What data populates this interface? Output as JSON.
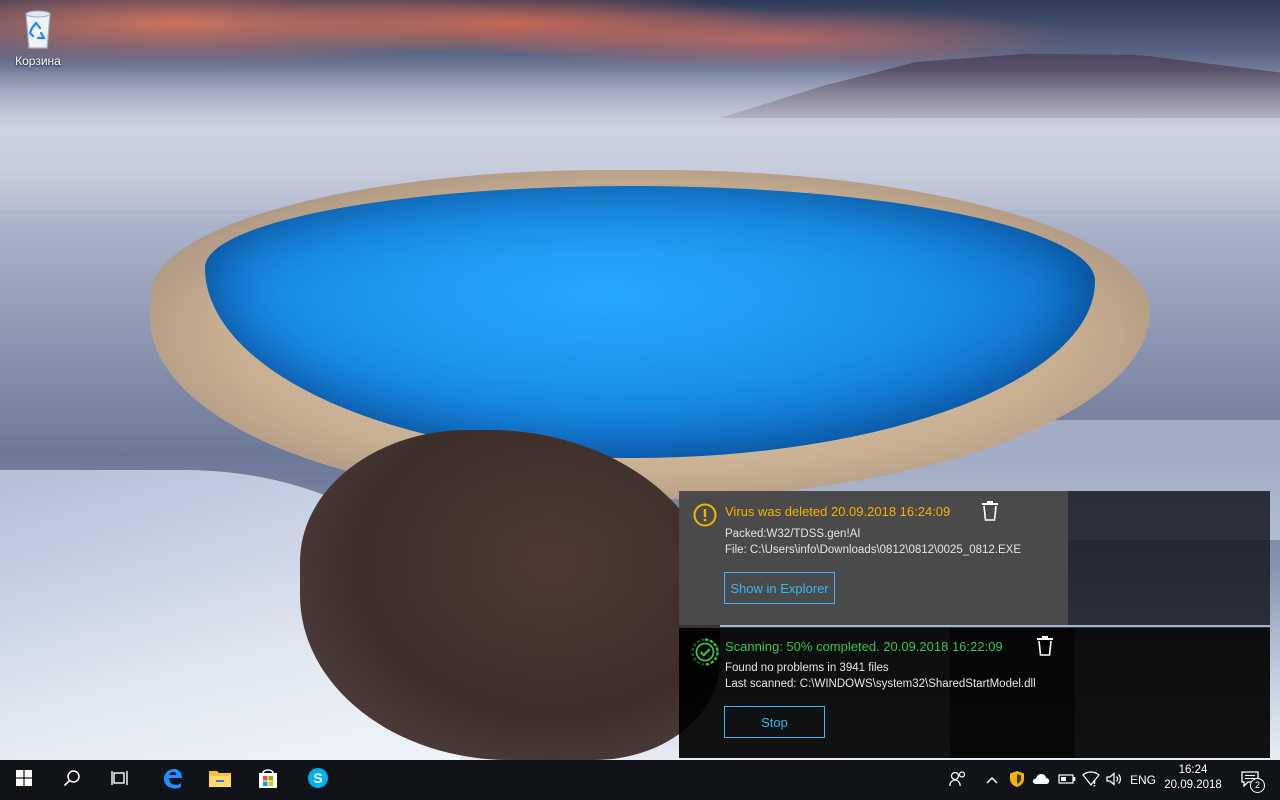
{
  "desktop": {
    "recycle_bin_label": "Корзина"
  },
  "notifications": {
    "virus": {
      "title": "Virus was deleted 20.09.2018 16:24:09",
      "line1": "Packed:W32/TDSS.gen!AI",
      "line2": "File: C:\\Users\\info\\Downloads\\0812\\0812\\0025_0812.EXE",
      "button_label": "Show in Explorer",
      "accent_color": "#f5b400",
      "icon": "warning-icon"
    },
    "scan": {
      "title": "Scanning: 50% completed.  20.09.2018 16:22:09",
      "progress_percent": 50,
      "line1": "Found no problems in 3941 files",
      "line2": "Last scanned: C:\\WINDOWS\\system32\\SharedStartModel.dll",
      "button_label": "Stop",
      "accent_color": "#3dc44a",
      "icon": "check-circle-icon"
    }
  },
  "taskbar": {
    "pinned": [
      "start-icon",
      "search-icon",
      "task-view-icon",
      "edge-icon",
      "file-explorer-icon",
      "store-icon",
      "skype-icon"
    ],
    "tray": {
      "language": "ENG",
      "time": "16:24",
      "date": "20.09.2018",
      "notification_count": "2"
    }
  }
}
